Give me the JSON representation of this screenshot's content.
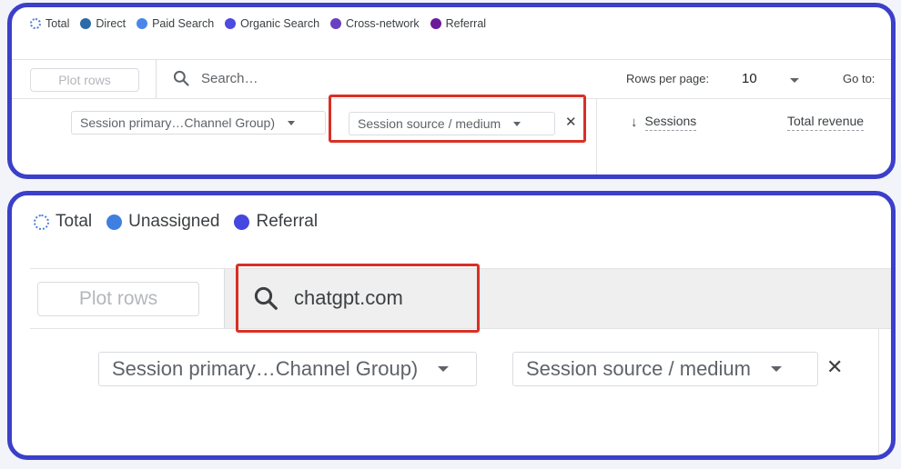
{
  "colors": {
    "frame": "#3b3fc9",
    "highlight": "#d93025",
    "direct": "#2c6aa8",
    "paid_search": "#4a86e8",
    "organic_search": "#4f4ae0",
    "cross_network": "#6a3fc0",
    "referral_top": "#6a1b9a",
    "unassigned": "#3f7fe0",
    "referral_bottom": "#4646e0"
  },
  "top": {
    "legend": [
      "Total",
      "Direct",
      "Paid Search",
      "Organic Search",
      "Cross-network",
      "Referral"
    ],
    "plot_rows": "Plot rows",
    "search_placeholder": "Search…",
    "rows_per_page_label": "Rows per page:",
    "rows_per_page_value": "10",
    "go_to_label": "Go to:",
    "dimension_1": "Session primary…Channel Group)",
    "dimension_2": "Session source / medium",
    "remove_symbol": "✕",
    "sort_arrow": "↓",
    "col_sessions": "Sessions",
    "col_total_revenue": "Total revenue"
  },
  "bottom": {
    "legend": [
      "Total",
      "Unassigned",
      "Referral"
    ],
    "plot_rows": "Plot rows",
    "search_value": "chatgpt.com",
    "dimension_1": "Session primary…Channel Group)",
    "dimension_2": "Session source / medium",
    "remove_symbol": "✕"
  },
  "icons": [
    "search-icon",
    "close-icon",
    "chevron-down-icon",
    "arrow-down-icon"
  ]
}
